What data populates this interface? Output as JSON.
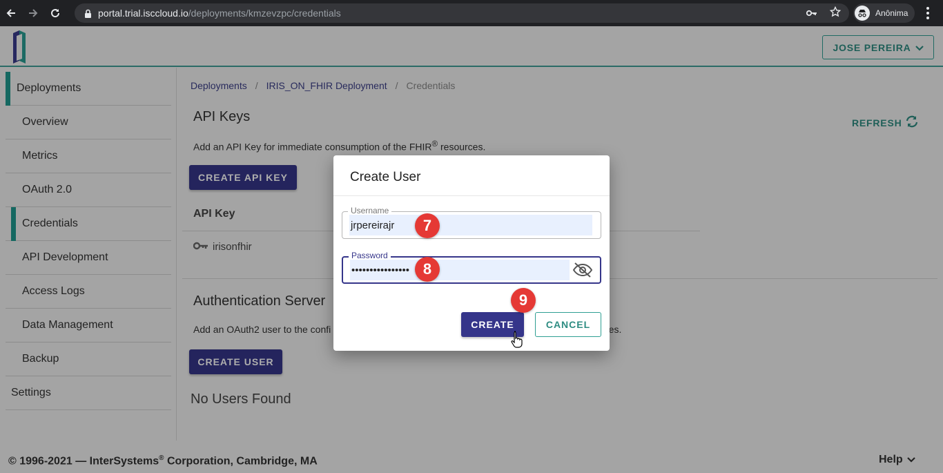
{
  "browser": {
    "url_host": "portal.trial.isccloud.io",
    "url_path": "/deployments/kmzevzpc/credentials",
    "profile_label": "Anônima"
  },
  "header": {
    "user_button_label": "JOSE PEREIRA"
  },
  "sidebar": {
    "items": [
      {
        "label": "Deployments"
      },
      {
        "label": "Overview"
      },
      {
        "label": "Metrics"
      },
      {
        "label": "OAuth 2.0"
      },
      {
        "label": "Credentials"
      },
      {
        "label": "API Development"
      },
      {
        "label": "Access Logs"
      },
      {
        "label": "Data Management"
      },
      {
        "label": "Backup"
      },
      {
        "label": "Settings"
      }
    ]
  },
  "breadcrumb": {
    "items": [
      "Deployments",
      "IRIS_ON_FHIR Deployment",
      "Credentials"
    ],
    "separator": "/"
  },
  "api_keys": {
    "title": "API Keys",
    "refresh_label": "REFRESH",
    "description": "Add an API Key for immediate consumption of the FHIR",
    "description_sup": "®",
    "description_end": " resources.",
    "create_button": "CREATE API KEY",
    "column_header": "API Key",
    "rows": [
      "irisonfhir"
    ]
  },
  "auth_server": {
    "title": "Authentication Server",
    "description_start": "Add an OAuth2 user to the confi",
    "description_end": "rces.",
    "create_button": "CREATE USER",
    "empty_text": "No Users Found"
  },
  "dialog": {
    "title": "Create User",
    "username_label": "Username",
    "username_value": "jrpereirajr",
    "password_label": "Password",
    "password_value": "••••••••••••••••",
    "create_button": "CREATE",
    "cancel_button": "CANCEL"
  },
  "markers": [
    "7",
    "8",
    "9"
  ],
  "footer": {
    "copyright_start": "© 1996-2021 — InterSystems",
    "copyright_sup": "®",
    "copyright_end": " Corporation, Cambridge, MA",
    "help_label": "Help"
  },
  "colors": {
    "primary": "#35358a",
    "accent": "#2e9e92",
    "marker": "#e53935"
  },
  "icons": [
    "back-icon",
    "forward-icon",
    "reload-icon",
    "lock-icon",
    "key-icon",
    "star-icon",
    "incognito-icon",
    "menu-dots-icon",
    "chevron-down-icon",
    "refresh-icon",
    "eye-off-icon",
    "pointer-cursor-icon"
  ]
}
